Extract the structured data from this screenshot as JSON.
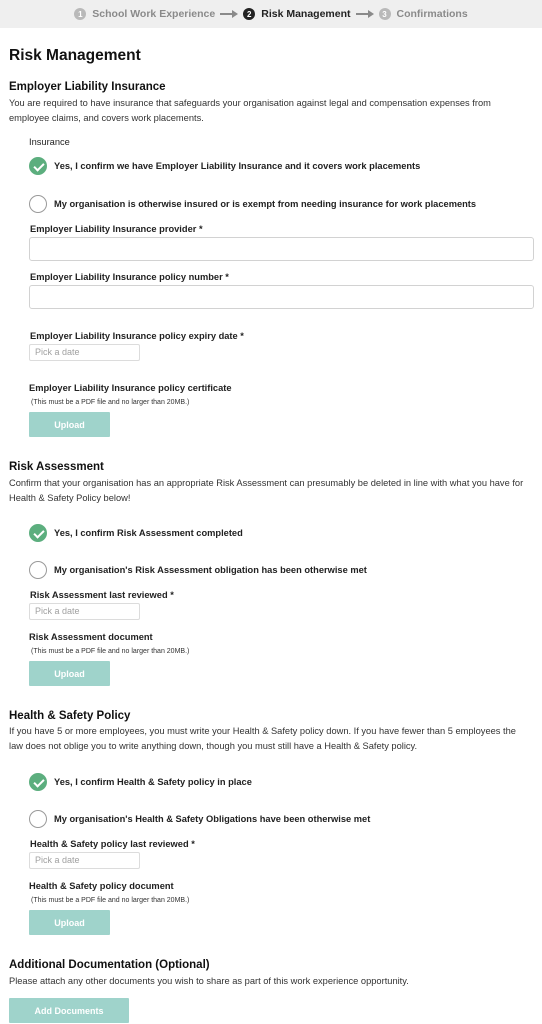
{
  "stepper": {
    "steps": [
      {
        "num": "1",
        "label": "School Work Experience"
      },
      {
        "num": "2",
        "label": "Risk Management"
      },
      {
        "num": "3",
        "label": "Confirmations"
      }
    ]
  },
  "page_title": "Risk Management",
  "eli": {
    "title": "Employer Liability Insurance",
    "desc": "You are required to have insurance that safeguards your organisation against legal and compensation expenses from employee claims, and covers work placements.",
    "group_label": "Insurance",
    "opt_yes": "Yes, I confirm we have Employer Liability Insurance and it covers work placements",
    "opt_other": "My organisation is otherwise insured or is exempt from needing insurance for work placements",
    "provider_label": "Employer Liability Insurance provider *",
    "policy_number_label": "Employer Liability Insurance policy number *",
    "expiry_label": "Employer Liability Insurance policy expiry date *",
    "date_placeholder": "Pick a date",
    "certificate_label": "Employer Liability Insurance policy certificate",
    "hint": "(This must be a PDF file and no larger than 20MB.)",
    "upload": "Upload"
  },
  "risk": {
    "title": "Risk Assessment",
    "desc": "Confirm that your organisation has an appropriate Risk Assessment can presumably be deleted in line with what you have for Health & Safety Policy below!",
    "opt_yes": "Yes, I confirm Risk Assessment completed",
    "opt_other": "My organisation's Risk Assessment obligation has been otherwise met",
    "reviewed_label": "Risk Assessment last reviewed *",
    "date_placeholder": "Pick a date",
    "doc_label": "Risk Assessment document",
    "hint": "(This must be a PDF file and no larger than 20MB.)",
    "upload": "Upload"
  },
  "hs": {
    "title": "Health & Safety Policy",
    "desc": "If you have 5 or more employees, you must write your Health & Safety policy down. If you have fewer than 5 employees the law does not oblige you to write anything down, though you must still have a Health & Safety policy.",
    "opt_yes": "Yes, I confirm Health & Safety policy in place",
    "opt_other": "My organisation's Health & Safety Obligations have been otherwise met",
    "reviewed_label": "Health & Safety policy last reviewed *",
    "date_placeholder": "Pick a date",
    "doc_label": "Health & Safety policy document",
    "hint": "(This must be a PDF file and no larger than 20MB.)",
    "upload": "Upload"
  },
  "additional": {
    "title": "Additional Documentation (Optional)",
    "desc": "Please attach any other documents you wish to share as part of this work experience opportunity.",
    "button": "Add Documents"
  },
  "colors": {
    "accent_button": "#9fd3cb",
    "check_green": "#5cae7e",
    "stepper_bg": "#efefef"
  }
}
